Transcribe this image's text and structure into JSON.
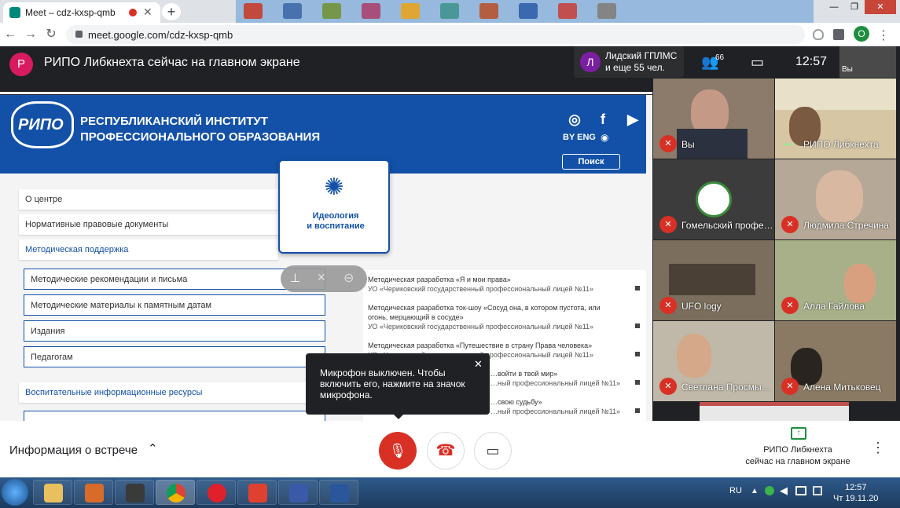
{
  "browser": {
    "tab_title": "Meet – cdz-kxsp-qmb",
    "tab_close": "✕",
    "new_tab": "+",
    "url": "meet.google.com/cdz-kxsp-qmb",
    "profile_initial": "O",
    "nav_back": "←",
    "nav_forward": "→",
    "nav_reload": "↻",
    "window_buttons": [
      "—",
      "❐",
      "✕"
    ]
  },
  "meet": {
    "banner": {
      "avatar_initial": "Р",
      "text": "РИПО Либкнехта сейчас на главном экране"
    },
    "presenter_chip": {
      "avatar_initial": "Л",
      "line1": "Лидский ГПЛМС",
      "line2": "и еще 55 чел."
    },
    "people_count": "66",
    "clock": "12:57",
    "self_label": "Вы",
    "participants": [
      {
        "name": "Вы",
        "muted": true
      },
      {
        "name": "РИПО Либкнехта",
        "muted": false
      },
      {
        "name": "Гомельский профе…",
        "muted": true
      },
      {
        "name": "Людмила Стречина",
        "muted": true
      },
      {
        "name": "UFO logy",
        "muted": true
      },
      {
        "name": "Алла Гайлова",
        "muted": true
      },
      {
        "name": "Светлана Просмы…",
        "muted": true
      },
      {
        "name": "Алена Митьковец",
        "muted": true
      }
    ],
    "tooltip": {
      "text": "Микрофон выключен. Чтобы включить его, нажмите на значок микрофона.",
      "close": "✕"
    },
    "bottom": {
      "meeting_info": "Информация о встрече",
      "caret": "⌃",
      "presenting_line1": "РИПО Либкнехта",
      "presenting_line2": "сейчас на главном экране",
      "more": "⋮"
    }
  },
  "shared_site": {
    "logo_text": "РИПО",
    "name_line1": "РЕСПУБЛИКАНСКИЙ ИНСТИТУТ",
    "name_line2": "ПРОФЕССИОНАЛЬНОГО ОБРАЗОВАНИЯ",
    "lang": "BY  ENG",
    "search": "Поиск",
    "menu": [
      "О центре",
      "Нормативные правовые документы",
      "Методическая поддержка"
    ],
    "submenu": [
      "Методические рекомендации и письма",
      "Методические материалы к памятным датам",
      "Издания",
      "Педагогам"
    ],
    "resources": "Воспитательные информационные ресурсы",
    "card_label_line1": "Идеология",
    "card_label_line2": "и воспитание",
    "docs": [
      {
        "title": "Методическая разработка «Я и мои права»",
        "org": "УО «Чериковский государственный профессиональный лицей №11»"
      },
      {
        "title": "Методическая разработка ток-шоу «Сосуд она, в котором пустота, или огонь, мерцающий в сосуде»",
        "org": "УО «Чериковский государственный профессиональный лицей №11»"
      },
      {
        "title": "Методическая разработка «Путешествие в страну Права человека»",
        "org": "УО «Чериковский государственный профессиональный лицей №11»"
      },
      {
        "title": "…войти в твой мир»",
        "org": "…ный профессиональный лицей №11»"
      },
      {
        "title": "…свою судьбу»",
        "org": "…ный профессиональный лицей №11»"
      }
    ]
  },
  "taskbar": {
    "lang": "RU",
    "time": "12:57",
    "date": "Чт 19.11.20"
  }
}
